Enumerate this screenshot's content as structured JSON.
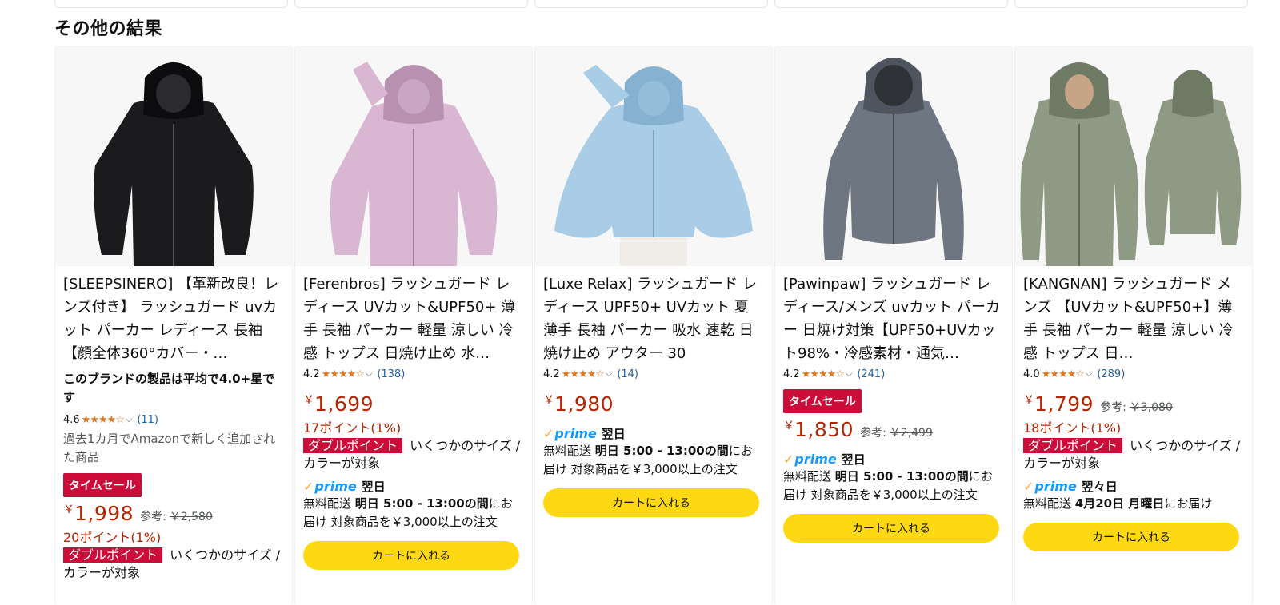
{
  "section": {
    "title": "その他の結果"
  },
  "products": [
    {
      "title": "[SLEEPSINERO] 【革新改良！レンズ付き】 ラッシュガード uvカット パーカー レディース 長袖 【顔全体360°カバー・…",
      "brand_note": "このブランドの製品は平均で4.0+星です",
      "rating": "4.6",
      "stars": "★★★★☆",
      "review_count": "(11)",
      "new_note": "過去1カ月でAmazonで新しく追加された商品",
      "deal_badge": "タイムセール",
      "price_symbol": "￥",
      "price": "1,998",
      "ref_label": "参考:",
      "ref_price": "￥2,580",
      "points": "20ポイント(1%)",
      "double_point_badge": "ダブルポイント",
      "double_point_text": "いくつかのサイズ / カラーが対象",
      "color_body": "#1b1b1e",
      "color_shade": "#0c0c0e"
    },
    {
      "title": "[Ferenbros] ラッシュガード レディース UVカット&UPF50+ 薄手 長袖 パーカー 軽量 涼しい 冷感 トップス 日焼け止め 水…",
      "rating": "4.2",
      "stars": "★★★★☆",
      "review_count": "(138)",
      "price_symbol": "￥",
      "price": "1,699",
      "points": "17ポイント(1%)",
      "double_point_badge": "ダブルポイント",
      "double_point_text": "いくつかのサイズ / カラーが対象",
      "prime_check": "✓",
      "prime_label": "prime",
      "delivery_day": "翌日",
      "ship_prefix": "無料配送",
      "ship_time": "明日 5:00 - 13:00の間",
      "ship_suffix": "にお届け 対象商品を￥3,000以上の注文",
      "cart_label": "カートに入れる",
      "color_body": "#d9b6d1",
      "color_shade": "#b991b0"
    },
    {
      "title": "[Luxe Relax] ラッシュガード レディース UPF50+ UVカット 夏 薄手 長袖 パーカー 吸水 速乾 日焼け止め アウター 30",
      "rating": "4.2",
      "stars": "★★★★☆",
      "review_count": "(14)",
      "price_symbol": "￥",
      "price": "1,980",
      "prime_check": "✓",
      "prime_label": "prime",
      "delivery_day": "翌日",
      "ship_prefix": "無料配送",
      "ship_time": "明日 5:00 - 13:00の間",
      "ship_suffix": "にお届け 対象商品を￥3,000以上の注文",
      "cart_label": "カートに入れる",
      "color_body": "#a9cde6",
      "color_shade": "#86b1d1"
    },
    {
      "title": "[Pawinpaw] ラッシュガード レディース/メンズ uvカット パーカー 日焼け対策【UPF50+UVカット98%・冷感素材・通気…",
      "rating": "4.2",
      "stars": "★★★★☆",
      "review_count": "(241)",
      "deal_badge": "タイムセール",
      "price_symbol": "￥",
      "price": "1,850",
      "ref_label": "参考:",
      "ref_price": "￥2,499",
      "prime_check": "✓",
      "prime_label": "prime",
      "delivery_day": "翌日",
      "ship_prefix": "無料配送",
      "ship_time": "明日 5:00 - 13:00の間",
      "ship_suffix": "にお届け 対象商品を￥3,000以上の注文",
      "cart_label": "カートに入れる",
      "color_body": "#6e7681",
      "color_shade": "#4e555e"
    },
    {
      "title": "[KANGNAN] ラッシュガード メンズ 【UVカット&UPF50+】薄手 長袖 パーカー 軽量 涼しい 冷感 トップス 日…",
      "rating": "4.0",
      "stars": "★★★★☆",
      "review_count": "(289)",
      "price_symbol": "￥",
      "price": "1,799",
      "ref_label": "参考:",
      "ref_price": "￥3,080",
      "points": "18ポイント(1%)",
      "double_point_badge": "ダブルポイント",
      "double_point_text": "いくつかのサイズ / カラーが対象",
      "prime_check": "✓",
      "prime_label": "prime",
      "delivery_day": "翌々日",
      "ship_prefix": "無料配送",
      "ship_time": "4月20日 月曜日",
      "ship_suffix": "にお届け",
      "cart_label": "カートに入れる",
      "color_body": "#8f9a84",
      "color_shade": "#6f7a65"
    }
  ]
}
